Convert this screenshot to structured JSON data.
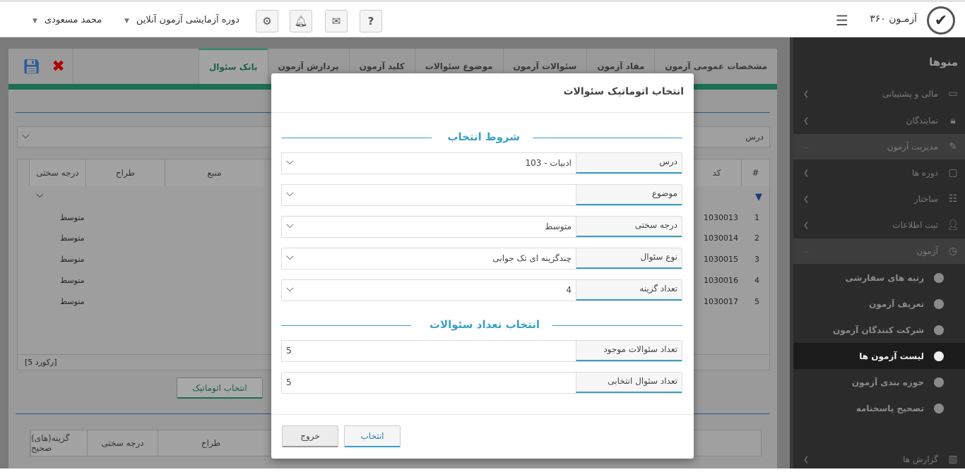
{
  "app": {
    "title": "آزمـون ۳۶۰"
  },
  "topbar": {
    "user": "محمد مسعودی",
    "course": "دوره آزمایشی آزمون آنلاین",
    "help": "?"
  },
  "tabs": [
    "مشخصات عمومی آزمون",
    "مفاد آزمون",
    "سئوالات آزمون",
    "موضوع سئوالات",
    "کلید آزمون",
    "پردازش آزمون",
    "بانک سئوال"
  ],
  "filter": {
    "label": "درس"
  },
  "grid": {
    "headers": [
      "#",
      "کد",
      "درجه سختی",
      "طراح",
      "منبع"
    ],
    "rows": [
      {
        "n": "1",
        "code": "1030013",
        "level": "متوسط"
      },
      {
        "n": "2",
        "code": "1030014",
        "level": "متوسط"
      },
      {
        "n": "3",
        "code": "1030015",
        "level": "متوسط"
      },
      {
        "n": "4",
        "code": "1030016",
        "level": "متوسط"
      },
      {
        "n": "5",
        "code": "1030017",
        "level": "متوسط"
      }
    ],
    "records": "[5 رکورد]"
  },
  "auto_button": "انتخاب اتوماتیک",
  "grid2": {
    "headers": [
      "گزینه(های) صحیح",
      "درجه سختی",
      "طراح"
    ]
  },
  "sidebar": {
    "title": "منوها",
    "items": [
      {
        "label": "مالی و پشتیبانی",
        "icon": "card-icon"
      },
      {
        "label": "نمایندگان",
        "icon": "lock-icon"
      },
      {
        "label": "مدیریت آزمون",
        "icon": "edit-icon"
      },
      {
        "label": "دوره ها",
        "icon": "folder-icon"
      },
      {
        "label": "ساختار",
        "icon": "sitemap-icon"
      },
      {
        "label": "ثبت اطلاعات",
        "icon": "user-add-icon"
      },
      {
        "label": "آزمون",
        "icon": "clock-icon"
      }
    ],
    "subitems": [
      "رتبه های سفارشی",
      "تعریف آزمون",
      "شرکت کنندگان آزمون",
      "لیست آزمون ها",
      "حوزه بندی آزمون",
      "تصحیح پاسخنامه"
    ],
    "bottom": "گزارش ها"
  },
  "modal": {
    "title": "انتخاب اتوماتیک سئوالات",
    "section1": "شروط انتخاب",
    "fields": [
      {
        "label": "درس",
        "value": "103 - ادبیات"
      },
      {
        "label": "موضوع",
        "value": ""
      },
      {
        "label": "درجه سختی",
        "value": "متوسط"
      },
      {
        "label": "نوع سئوال",
        "value": "چندگزینه ای تک جوابی"
      },
      {
        "label": "تعداد گزینه",
        "value": "4"
      }
    ],
    "section2": "انتخاب تعداد سئوالات",
    "counts": [
      {
        "label": "تعداد سئوالات موجود",
        "value": "5"
      },
      {
        "label": "تعداد سئوال انتخابی",
        "value": "5"
      }
    ],
    "select_button": "انتخاب",
    "exit_button": "خروج"
  }
}
